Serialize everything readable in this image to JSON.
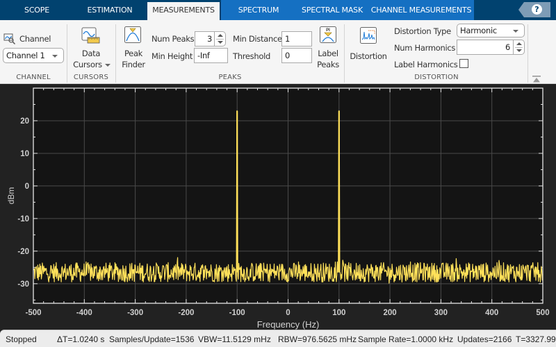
{
  "tabs": [
    {
      "label": "SCOPE",
      "active": false
    },
    {
      "label": "ESTIMATION",
      "active": false
    },
    {
      "label": "MEASUREMENTS",
      "active": true
    },
    {
      "label": "SPECTRUM",
      "active": false
    },
    {
      "label": "SPECTRAL MASK",
      "active": false
    },
    {
      "label": "CHANNEL MEASUREMENTS",
      "active": false
    }
  ],
  "help": {
    "label": "?",
    "icon": "help-icon"
  },
  "toolstrip": {
    "channel": {
      "label": "Channel",
      "icon": "channel-select-icon",
      "selected": "Channel 1",
      "section_title": "CHANNEL"
    },
    "cursors": {
      "button_line1": "Data",
      "button_line2": "Cursors",
      "icon": "data-cursors-icon",
      "section_title": "CURSORS"
    },
    "peaks": {
      "peak_finder_line1": "Peak",
      "peak_finder_line2": "Finder",
      "peak_finder_icon": "peak-finder-icon",
      "num_peaks_label": "Num Peaks",
      "num_peaks_value": "3",
      "min_height_label": "Min Height",
      "min_height_value": "-Inf",
      "min_distance_label": "Min Distance",
      "min_distance_value": "1",
      "threshold_label": "Threshold",
      "threshold_value": "0",
      "label_peaks_line1": "Label",
      "label_peaks_line2": "Peaks",
      "label_peaks_icon": "label-peaks-icon",
      "section_title": "PEAKS"
    },
    "distortion": {
      "button_label": "Distortion",
      "icon": "distortion-icon",
      "type_label": "Distortion Type",
      "type_value": "Harmonic",
      "num_harmonics_label": "Num Harmonics",
      "num_harmonics_value": "6",
      "label_harmonics_label": "Label Harmonics",
      "label_harmonics_checked": false,
      "section_title": "DISTORTION"
    }
  },
  "chart_data": {
    "type": "line",
    "title": "",
    "xlabel": "Frequency (Hz)",
    "ylabel": "dBm",
    "xlim": [
      -500,
      500
    ],
    "ylim": [
      -36,
      30
    ],
    "xticks": [
      -500,
      -400,
      -300,
      -200,
      -100,
      0,
      100,
      200,
      300,
      400,
      500
    ],
    "yticks": [
      -30,
      -20,
      -10,
      0,
      10,
      20
    ],
    "grid": true,
    "series": [
      {
        "name": "Channel 1",
        "color": "#ffe15a",
        "noise_floor_dbm": -26.5,
        "noise_spread_db": 3,
        "peaks": [
          {
            "x": -100,
            "y": 23
          },
          {
            "x": 100,
            "y": 23
          }
        ]
      }
    ],
    "colors": {
      "background": "#141414",
      "figure": "#222222",
      "grid": "#4a4a4a",
      "axes": "#e6e6e6",
      "text": "#d0d0d0"
    }
  },
  "status": {
    "state": "Stopped",
    "delta_t": "ΔT=1.0240 s",
    "samples_per_update": "Samples/Update=1536",
    "vbw": "VBW=11.5129 mHz",
    "rbw": "RBW=976.5625 mHz",
    "sample_rate": "Sample Rate=1.0000 kHz",
    "updates": "Updates=2166",
    "t": "T=3327.99"
  }
}
